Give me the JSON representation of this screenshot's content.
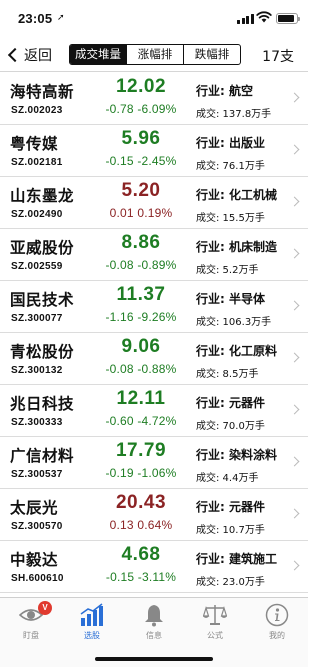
{
  "status": {
    "time": "23:05",
    "location_icon": "location-arrow-icon"
  },
  "nav": {
    "back_label": "返回",
    "tabs": [
      {
        "label": "成交堆量",
        "active": true
      },
      {
        "label": "涨幅排",
        "active": false
      },
      {
        "label": "跌幅排",
        "active": false
      }
    ],
    "count": "17支"
  },
  "rows": [
    {
      "name": "海特高新",
      "code": "SZ.002023",
      "price": "12.02",
      "change": "-0.78 -6.09%",
      "direction": "down",
      "industry": "行业: 航空",
      "volume": "成交: 137.8万手"
    },
    {
      "name": "粤传媒",
      "code": "SZ.002181",
      "price": "5.96",
      "change": "-0.15 -2.45%",
      "direction": "down",
      "industry": "行业: 出版业",
      "volume": "成交: 76.1万手"
    },
    {
      "name": "山东墨龙",
      "code": "SZ.002490",
      "price": "5.20",
      "change": "0.01 0.19%",
      "direction": "up",
      "industry": "行业: 化工机械",
      "volume": "成交: 15.5万手"
    },
    {
      "name": "亚威股份",
      "code": "SZ.002559",
      "price": "8.86",
      "change": "-0.08 -0.89%",
      "direction": "down",
      "industry": "行业: 机床制造",
      "volume": "成交: 5.2万手"
    },
    {
      "name": "国民技术",
      "code": "SZ.300077",
      "price": "11.37",
      "change": "-1.16 -9.26%",
      "direction": "down",
      "industry": "行业: 半导体",
      "volume": "成交: 106.3万手"
    },
    {
      "name": "青松股份",
      "code": "SZ.300132",
      "price": "9.06",
      "change": "-0.08 -0.88%",
      "direction": "down",
      "industry": "行业: 化工原料",
      "volume": "成交: 8.5万手"
    },
    {
      "name": "兆日科技",
      "code": "SZ.300333",
      "price": "12.11",
      "change": "-0.60 -4.72%",
      "direction": "down",
      "industry": "行业: 元器件",
      "volume": "成交: 70.0万手"
    },
    {
      "name": "广信材料",
      "code": "SZ.300537",
      "price": "17.79",
      "change": "-0.19 -1.06%",
      "direction": "down",
      "industry": "行业: 染料涂料",
      "volume": "成交: 4.4万手"
    },
    {
      "name": "太辰光",
      "code": "SZ.300570",
      "price": "20.43",
      "change": "0.13 0.64%",
      "direction": "up",
      "industry": "行业: 元器件",
      "volume": "成交: 10.7万手"
    },
    {
      "name": "中毅达",
      "code": "SH.600610",
      "price": "4.68",
      "change": "-0.15 -3.11%",
      "direction": "down",
      "industry": "行业: 建筑施工",
      "volume": "成交: 23.0万手"
    }
  ],
  "tabbar": {
    "items": [
      {
        "label": "盯盘",
        "icon": "eye-icon",
        "badge": "V",
        "active": false
      },
      {
        "label": "选股",
        "icon": "bar-chart-icon",
        "active": true
      },
      {
        "label": "信息",
        "icon": "bell-icon",
        "active": false
      },
      {
        "label": "公式",
        "icon": "scale-icon",
        "active": false
      },
      {
        "label": "我的",
        "icon": "info-icon",
        "active": false
      }
    ]
  },
  "colors": {
    "up": "#8b2324",
    "down": "#1e7d23",
    "tab_active": "#2a6fd6"
  }
}
